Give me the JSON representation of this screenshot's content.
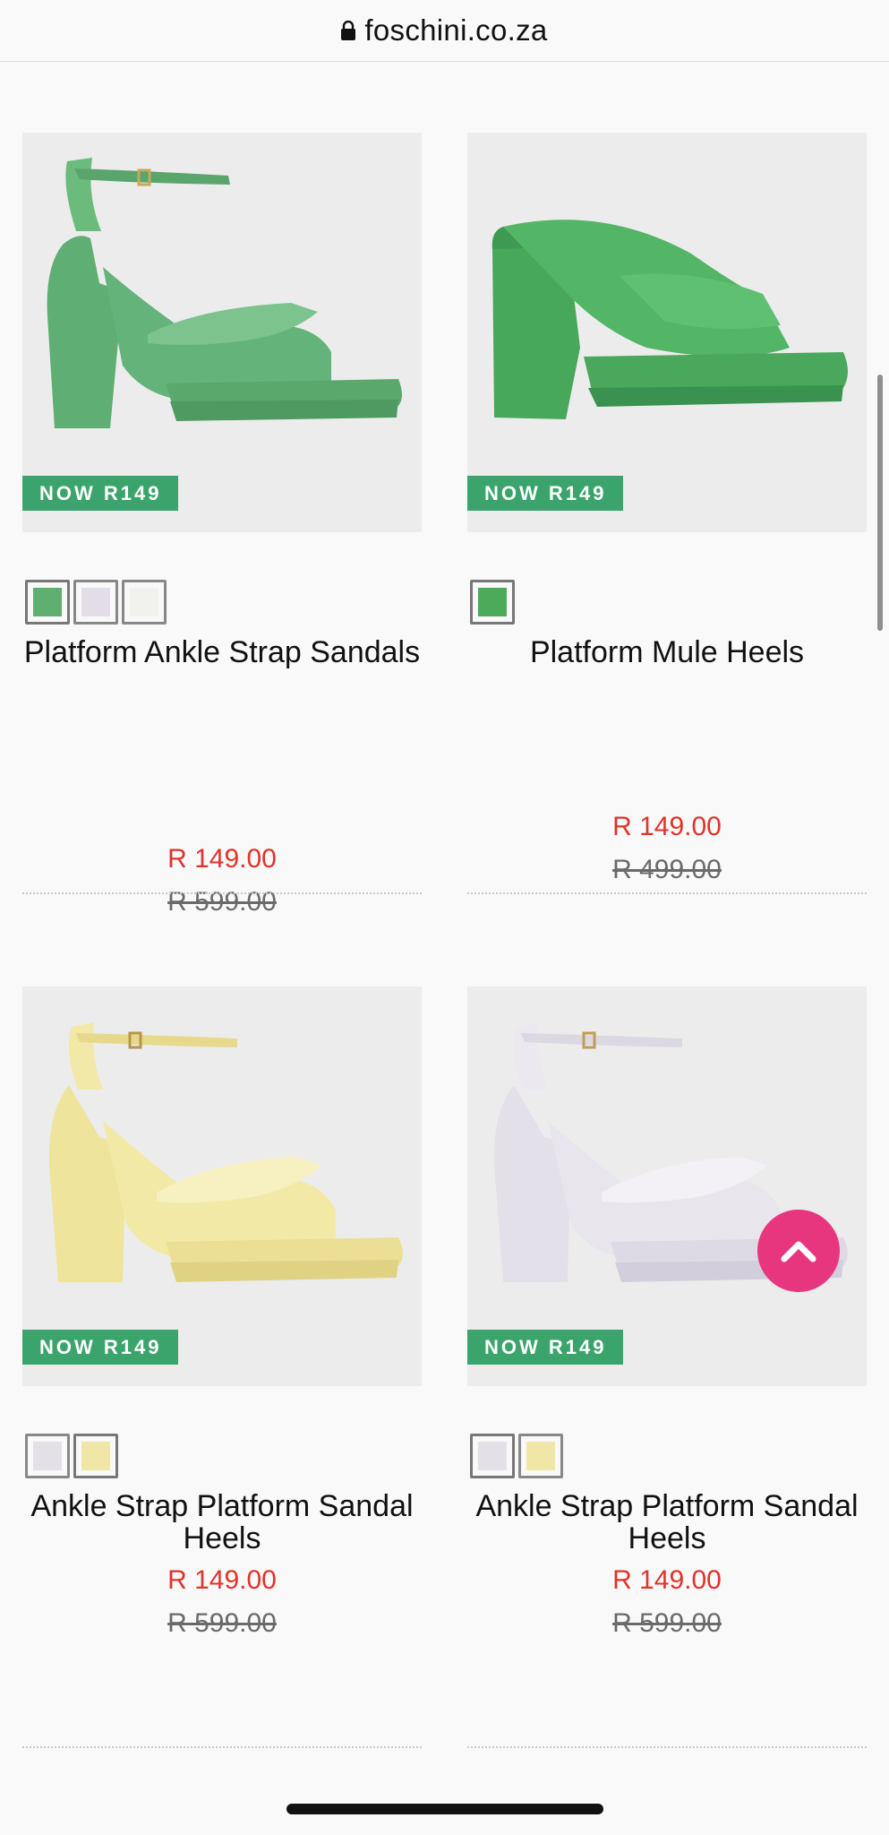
{
  "browser": {
    "domain": "foschini.co.za",
    "lock_icon": "lock-icon"
  },
  "products": [
    {
      "badge": "NOW R149",
      "title": "Platform Ankle Strap Sandals",
      "price_now": "R 149.00",
      "price_was": "R 599.00",
      "swatches": [
        "#5fb070",
        "#e2dde6",
        "#f1f1ee"
      ],
      "image": "green-ankle-strap-platform-sandal"
    },
    {
      "badge": "NOW R149",
      "title": "Platform Mule Heels",
      "price_now": "R 149.00",
      "price_was": "R 499.00",
      "swatches": [
        "#4cab5b"
      ],
      "image": "green-platform-mule-heel"
    },
    {
      "badge": "NOW R149",
      "title": "Ankle Strap Platform Sandal Heels",
      "price_now": "R 149.00",
      "price_was": "R 599.00",
      "swatches": [
        "#e3e0e8",
        "#f0e6a6"
      ],
      "image": "yellow-ankle-strap-platform-sandal"
    },
    {
      "badge": "NOW R149",
      "title": "Ankle Strap Platform Sandal Heels",
      "price_now": "R 149.00",
      "price_was": "R 599.00",
      "swatches": [
        "#e3e0e8",
        "#f0e6a6"
      ],
      "image": "lilac-ankle-strap-platform-sandal"
    }
  ],
  "scroll_top_button": {
    "icon": "chevron-up-icon",
    "color": "#e8367e"
  },
  "colors": {
    "badge": "#3aa46c",
    "sale_price": "#e0332a",
    "was_price": "#6a6a6a"
  }
}
